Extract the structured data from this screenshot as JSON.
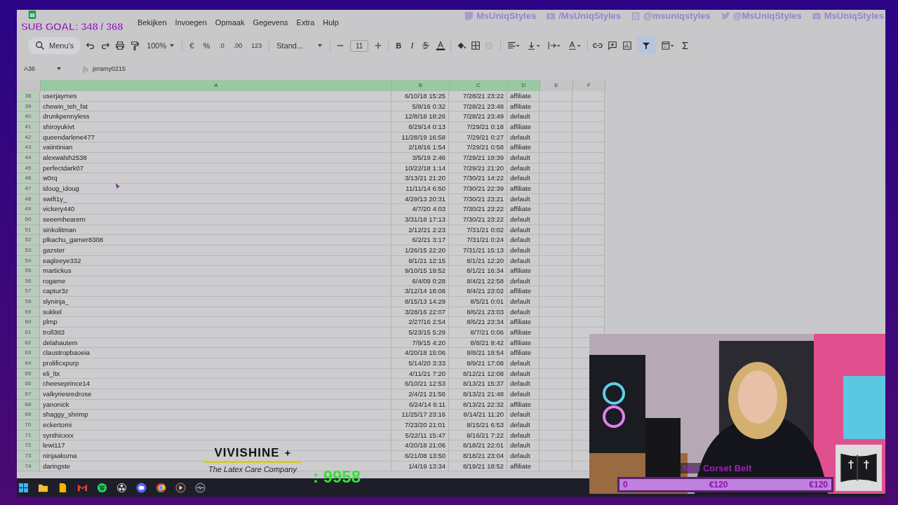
{
  "overlay": {
    "sub_goal": "SUB GOAL: 348 / 368",
    "socials": [
      {
        "kind": "twitch",
        "handle": "MsUniqStyles"
      },
      {
        "kind": "youtube",
        "handle": "/MsUniqStyles"
      },
      {
        "kind": "instagram",
        "handle": "@msuniqstyles"
      },
      {
        "kind": "twitter",
        "handle": "@MsUniqStyles"
      },
      {
        "kind": "discord",
        "handle": "MsUniqStyles"
      }
    ],
    "sponsor": {
      "name": "VIVISHINE",
      "tagline": "The Latex Care Company"
    },
    "counter": ": 9958",
    "goal": {
      "item": "Nun Corset Belt",
      "start": "0",
      "current": "€120",
      "target": "€120",
      "level": 1
    }
  },
  "menu": [
    "Bekijken",
    "Invoegen",
    "Opmaak",
    "Gegevens",
    "Extra",
    "Hulp"
  ],
  "toolbar": {
    "search": "Menu's",
    "zoom": "100%",
    "currency": "€",
    "percent": "%",
    "dec_less": ".0",
    "dec_more": ".00",
    "number_format": "123",
    "font": "Stand...",
    "font_size": "11",
    "bold": "B",
    "italic": "I",
    "filter_on": true
  },
  "formula_bar": {
    "cell": "A36",
    "fx": "fx",
    "value": "jeramy0215"
  },
  "columns": [
    {
      "label": "A",
      "selected": true
    },
    {
      "label": "B",
      "selected": true
    },
    {
      "label": "C",
      "selected": true
    },
    {
      "label": "D",
      "selected": true
    },
    {
      "label": "E",
      "selected": false
    },
    {
      "label": "F",
      "selected": false
    }
  ],
  "rows": [
    {
      "num": "38",
      "a": "userjaymes",
      "b": "6/10/18 15:25",
      "c": "7/28/21 23:22",
      "d": "affiliate"
    },
    {
      "num": "39",
      "a": "chewin_teh_fat",
      "b": "5/8/16 0:32",
      "c": "7/28/21 23:48",
      "d": "affiliate"
    },
    {
      "num": "40",
      "a": "drunkpennyless",
      "b": "12/8/18 18:26",
      "c": "7/28/21 23:49",
      "d": "default"
    },
    {
      "num": "41",
      "a": "shiroyukivt",
      "b": "8/29/14 0:13",
      "c": "7/29/21 0:18",
      "d": "affiliate"
    },
    {
      "num": "42",
      "a": "queendarlene477",
      "b": "11/28/19 16:58",
      "c": "7/29/21 0:27",
      "d": "default"
    },
    {
      "num": "43",
      "a": "vaiintinian",
      "b": "2/18/16 1:54",
      "c": "7/29/21 0:58",
      "d": "affiliate"
    },
    {
      "num": "44",
      "a": "alexwalsh2538",
      "b": "3/5/19 2:46",
      "c": "7/29/21 19:39",
      "d": "default"
    },
    {
      "num": "45",
      "a": "perfectdark07",
      "b": "10/22/18 1:14",
      "c": "7/29/21 21:20",
      "d": "default"
    },
    {
      "num": "46",
      "a": "w0rq",
      "b": "3/13/21 21:20",
      "c": "7/30/21 14:22",
      "d": "default"
    },
    {
      "num": "47",
      "a": "idoug_idoug",
      "b": "11/11/14 6:50",
      "c": "7/30/21 22:39",
      "d": "affiliate"
    },
    {
      "num": "48",
      "a": "swift1y_",
      "b": "4/29/13 20:31",
      "c": "7/30/21 23:21",
      "d": "default"
    },
    {
      "num": "49",
      "a": "vickery440",
      "b": "4/7/20 4:03",
      "c": "7/30/21 23:22",
      "d": "affiliate"
    },
    {
      "num": "50",
      "a": "seeemhearem",
      "b": "3/31/18 17:13",
      "c": "7/30/21 23:22",
      "d": "default"
    },
    {
      "num": "51",
      "a": "sinkolitman",
      "b": "2/12/21 2:23",
      "c": "7/31/21 0:02",
      "d": "default"
    },
    {
      "num": "52",
      "a": "plkachu_gamer8308",
      "b": "6/2/21 3:17",
      "c": "7/31/21 0:24",
      "d": "default"
    },
    {
      "num": "53",
      "a": "gazster",
      "b": "1/26/15 22:20",
      "c": "7/31/21 15:13",
      "d": "default"
    },
    {
      "num": "54",
      "a": "eagleeye332",
      "b": "8/1/21 12:15",
      "c": "8/1/21 12:20",
      "d": "default"
    },
    {
      "num": "55",
      "a": "martickus",
      "b": "9/10/15 19:52",
      "c": "8/1/21 16:34",
      "d": "affiliate"
    },
    {
      "num": "56",
      "a": "rogame",
      "b": "6/4/09 0:28",
      "c": "8/4/21 22:58",
      "d": "default"
    },
    {
      "num": "57",
      "a": "captur3z",
      "b": "3/12/14 18:08",
      "c": "8/4/21 23:02",
      "d": "affiliate"
    },
    {
      "num": "58",
      "a": "slyninja_",
      "b": "8/15/13 14:29",
      "c": "8/5/21 0:01",
      "d": "default"
    },
    {
      "num": "59",
      "a": "sukkel",
      "b": "3/28/16 22:07",
      "c": "8/6/21 23:03",
      "d": "default"
    },
    {
      "num": "60",
      "a": "plmp",
      "b": "2/27/16 2:54",
      "c": "8/6/21 23:34",
      "d": "affiliate"
    },
    {
      "num": "61",
      "a": "troll3tt3",
      "b": "5/23/15 5:29",
      "c": "8/7/21 0:06",
      "d": "affiliate"
    },
    {
      "num": "62",
      "a": "delahautem",
      "b": "7/9/15 4:20",
      "c": "8/8/21 9:42",
      "d": "affiliate"
    },
    {
      "num": "63",
      "a": "claustropbaoeia",
      "b": "4/20/18 15:06",
      "c": "8/8/21 19:54",
      "d": "affiliate"
    },
    {
      "num": "64",
      "a": "prolificxpurp",
      "b": "5/14/20 3:33",
      "c": "8/9/21 17:08",
      "d": "default"
    },
    {
      "num": "65",
      "a": "eli_ltx",
      "b": "4/11/21 7:20",
      "c": "8/12/21 12:08",
      "d": "default"
    },
    {
      "num": "66",
      "a": "cheeseprince14",
      "b": "6/10/21 12:53",
      "c": "8/13/21 15:37",
      "d": "default"
    },
    {
      "num": "67",
      "a": "valkyriesredrose",
      "b": "2/4/21 21:56",
      "c": "8/13/21 21:48",
      "d": "default"
    },
    {
      "num": "68",
      "a": "yanonick",
      "b": "6/24/14 6:11",
      "c": "8/13/21 22:32",
      "d": "affiliate"
    },
    {
      "num": "69",
      "a": "shaggy_shrimp",
      "b": "11/25/17 23:16",
      "c": "8/14/21 11:20",
      "d": "default"
    },
    {
      "num": "70",
      "a": "eckertomi",
      "b": "7/23/20 21:01",
      "c": "8/15/21 6:53",
      "d": "default"
    },
    {
      "num": "71",
      "a": "synthicxxx",
      "b": "5/22/11 15:47",
      "c": "8/16/21 7:22",
      "d": "default"
    },
    {
      "num": "72",
      "a": "lewi117",
      "b": "4/20/18 21:06",
      "c": "8/18/21 22:01",
      "d": "default"
    },
    {
      "num": "73",
      "a": "ninjaakuma",
      "b": "6/21/08 13:50",
      "c": "8/18/21 23:04",
      "d": "default"
    },
    {
      "num": "74",
      "a": "daringste",
      "b": "1/4/19 13:34",
      "c": "8/19/21 18:52",
      "d": "affiliate"
    }
  ],
  "taskbar": [
    {
      "kind": "start"
    },
    {
      "kind": "folder"
    },
    {
      "kind": "file"
    },
    {
      "kind": "mail"
    },
    {
      "kind": "music"
    },
    {
      "kind": "obs"
    },
    {
      "kind": "chat"
    },
    {
      "kind": "browser"
    },
    {
      "kind": "player"
    },
    {
      "kind": "audio"
    }
  ]
}
